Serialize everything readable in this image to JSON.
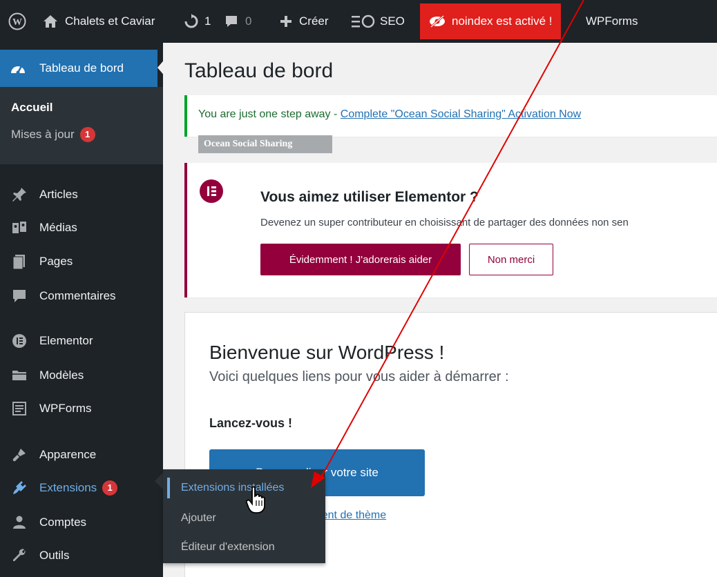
{
  "adminbar": {
    "site_name": "Chalets et Caviar",
    "updates_count": "1",
    "comments_count": "0",
    "new_label": "Créer",
    "seo_label": "SEO",
    "noindex_label": "noindex est activé !",
    "wpforms_label": "WPForms"
  },
  "sidebar": {
    "dashboard": "Tableau de bord",
    "home": "Accueil",
    "updates": "Mises à jour",
    "updates_badge": "1",
    "items": [
      {
        "label": "Articles"
      },
      {
        "label": "Médias"
      },
      {
        "label": "Pages"
      },
      {
        "label": "Commentaires"
      },
      {
        "label": "Elementor"
      },
      {
        "label": "Modèles"
      },
      {
        "label": "WPForms"
      },
      {
        "label": "Apparence"
      },
      {
        "label": "Extensions",
        "badge": "1"
      },
      {
        "label": "Comptes"
      },
      {
        "label": "Outils"
      }
    ]
  },
  "flyout": {
    "items": [
      "Extensions installées",
      "Ajouter",
      "Éditeur d'extension"
    ]
  },
  "main": {
    "title": "Tableau de bord",
    "ocean_notice_prefix": "You are just one step away - ",
    "ocean_notice_link": "Complete \"Ocean Social Sharing\" Activation Now",
    "ocean_tag": "Ocean Social Sharing",
    "elementor_title": "Vous aimez utiliser Elementor ?",
    "elementor_desc": "Devenez un super contributeur en choisissant de partager des données non sen",
    "elementor_yes": "Évidemment ! J'adorerais aider",
    "elementor_no": "Non merci",
    "welcome_title": "Bienvenue sur WordPress !",
    "welcome_sub": "Voici quelques liens pour vous aider à démarrer :",
    "welcome_h3": "Lancez-vous !",
    "welcome_button": "Personnaliser votre site",
    "welcome_link": "ou changer complètement de thème"
  },
  "colors": {
    "adminbar_bg": "#1d2327",
    "menu_current": "#2271b1",
    "noindex_bg": "#e0201c",
    "elementor": "#93003c",
    "annotation_arrow": "#e00000"
  }
}
